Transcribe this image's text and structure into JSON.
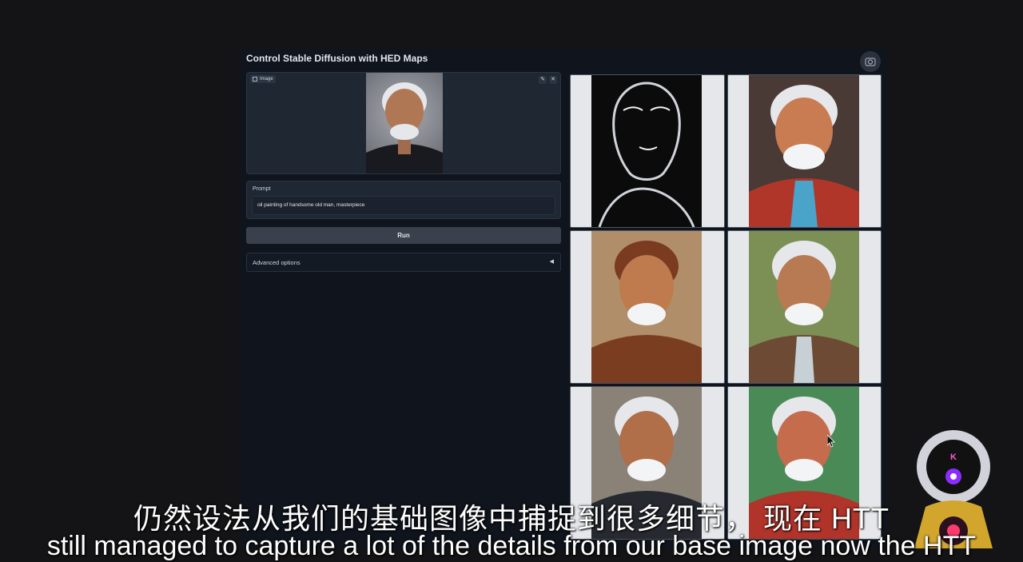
{
  "app": {
    "title": "Control Stable Diffusion with HED Maps"
  },
  "image_panel": {
    "label": "Image",
    "icons": [
      "image-icon",
      "edit-icon",
      "close-icon"
    ]
  },
  "prompt": {
    "label": "Prompt",
    "value": "oil painting of handsome old man, masterpiece"
  },
  "run_button": {
    "label": "Run"
  },
  "advanced": {
    "label": "Advanced options",
    "arrow": "◀"
  },
  "gallery": {
    "items": [
      {
        "kind": "edge-map"
      },
      {
        "kind": "portrait-red"
      },
      {
        "kind": "portrait-brown"
      },
      {
        "kind": "portrait-green"
      },
      {
        "kind": "portrait-dark"
      },
      {
        "kind": "portrait-red-green"
      }
    ]
  },
  "subtitles": {
    "zh": "仍然设法从我们的基础图像中捕捉到很多细节， 现在 HTT",
    "en": "still managed to capture a lot of the details from our base image now the HTT"
  },
  "mascot": {
    "letter": "K"
  },
  "colors": {
    "app_bg": "#0f141d",
    "panel_bg": "#1f2732",
    "accent_pink": "#ff56d0"
  }
}
